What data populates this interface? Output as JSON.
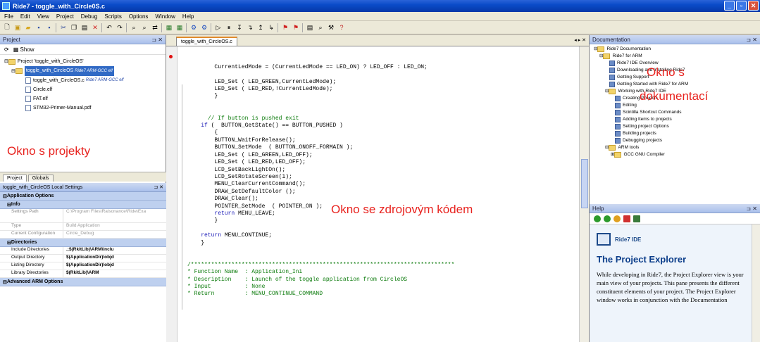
{
  "window": {
    "title": "Ride7 - toggle_with_Circle0S.c"
  },
  "menu": [
    "File",
    "Edit",
    "View",
    "Project",
    "Debug",
    "Scripts",
    "Options",
    "Window",
    "Help"
  ],
  "project_panel": {
    "header": "Project",
    "show_label": "Show",
    "tree": [
      {
        "label": "Project 'toggle_with_CircleOS'",
        "level": 0
      },
      {
        "label": "toggle_with_CircleOS",
        "extra": "Ride7 ARM-GCC elf",
        "level": 1,
        "selected": true
      },
      {
        "label": "toggle_with_CircleOS.c",
        "extra": "Ride7 ARM-GCC elf",
        "level": 2
      },
      {
        "label": "Circle.elf",
        "level": 2
      },
      {
        "label": "FAT.elf",
        "level": 2
      },
      {
        "label": "STM32-Primer-Manual.pdf",
        "level": 2
      }
    ],
    "annotation": "Okno s projekty"
  },
  "bottom_tabs": [
    "Project",
    "Globals"
  ],
  "settings_panel": {
    "title": "toggle_with_CircleOS Local Settings",
    "groups": [
      {
        "label": "Application Options"
      },
      {
        "label": "Info",
        "rows": [
          {
            "k": "Settings Path",
            "v": "C:\\Program Files\\Raisonance\\Ride\\Exa"
          },
          {
            "k": "Type",
            "v": "Build Application"
          },
          {
            "k": "Current Configuration",
            "v": "Circle_Debug"
          }
        ]
      },
      {
        "label": "Directories",
        "rows": [
          {
            "k": "Include Directories",
            "v": ".;$(RkitLib)\\ARM\\inclu"
          },
          {
            "k": "Output Directory",
            "v": "$(ApplicationDir)\\objd"
          },
          {
            "k": "Listing Directory",
            "v": "$(ApplicationDir)\\objd"
          },
          {
            "k": "Library Directories",
            "v": "$(RkitLib)\\ARM"
          }
        ]
      },
      {
        "label": "Advanced ARM Options"
      }
    ]
  },
  "editor": {
    "tab": "toggle_with_CircleOS.c",
    "tab_controls": "◂ ▸ ✕",
    "annotation": "Okno se zdrojovým kódem"
  },
  "docs_panel": {
    "header": "Documentation",
    "tree": [
      {
        "label": "Ride7 Documentation",
        "level": 0
      },
      {
        "label": "Ride7 for ARM",
        "level": 1
      },
      {
        "label": "Ride7 IDE Overview",
        "level": 2
      },
      {
        "label": "Downloading and Installing Ride7",
        "level": 2
      },
      {
        "label": "Getting Support",
        "level": 2
      },
      {
        "label": "Getting Started with Ride7 for ARM",
        "level": 2
      },
      {
        "label": "Working with Ride7 IDE",
        "level": 2
      },
      {
        "label": "Creating Projects",
        "level": 3
      },
      {
        "label": "Editing",
        "level": 3
      },
      {
        "label": "Scintilla Shortcut Commands",
        "level": 3
      },
      {
        "label": "Adding Items to projects",
        "level": 3
      },
      {
        "label": "Setting project Options",
        "level": 3
      },
      {
        "label": "Building projects",
        "level": 3
      },
      {
        "label": "Debugging projects",
        "level": 3
      },
      {
        "label": "ARM tools",
        "level": 2
      },
      {
        "label": "GCC GNU Compiler",
        "level": 3
      }
    ],
    "annotation_line1": "Okno s",
    "annotation_line2": "dokumentací"
  },
  "help_panel": {
    "header": "Help",
    "logo_text": "Ride7 IDE",
    "heading": "The Project Explorer",
    "paragraph": "While developing in Ride7, the Project Explorer view is your main view of your projects. This pane presents the different constituent elements of your project. The Project Explorer window works in conjunction with the Documentation"
  }
}
